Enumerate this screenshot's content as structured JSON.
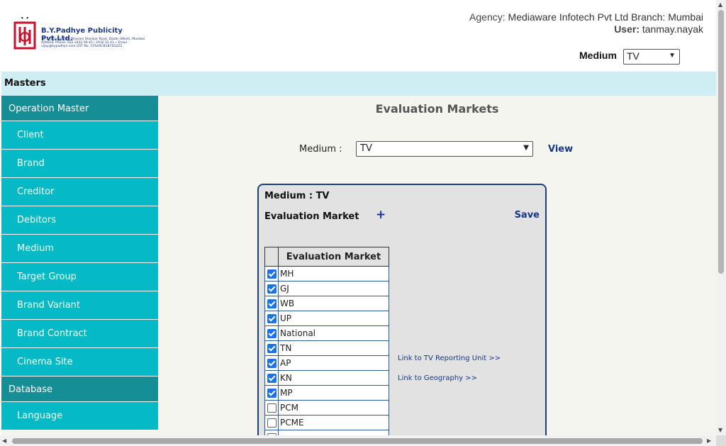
{
  "header": {
    "logo_name": "B.Y.Padhye Publicity Pvt.Ltd.",
    "logo_address": "32-E, Shivganesh, Bhavani Shankar Road, Dadar (West), Mumbai 400028. Phone: 022 2432 06 45 / 2432 52 41 • Email : vijay@bypadhye.com GST No. 27AAACB1871D2Z2",
    "agency_label": "Agency:",
    "agency_value": "Mediaware Infotech Pvt Ltd Branch: Mumbai",
    "user_label": "User:",
    "user_value": "tanmay.nayak",
    "medium_label": "Medium",
    "medium_value": "TV"
  },
  "masters_bar": {
    "label": "Masters"
  },
  "sidebar": {
    "groups": [
      {
        "label": "Operation Master",
        "items": [
          "Client",
          "Brand",
          "Creditor",
          "Debitors",
          "Medium",
          "Target Group",
          "Brand Variant",
          "Brand Contract",
          "Cinema Site"
        ]
      },
      {
        "label": "Database",
        "items": [
          "Language"
        ]
      }
    ]
  },
  "main": {
    "title": "Evaluation Markets",
    "medium_label": "Medium :",
    "medium_value": "TV",
    "view_label": "View",
    "panel": {
      "medium_caption": "Medium : TV",
      "evaluation_market_label": "Evaluation Market",
      "add_symbol": "+",
      "save_label": "Save",
      "grid_header": "Evaluation Market",
      "rows": [
        {
          "name": "MH",
          "checked": true
        },
        {
          "name": "GJ",
          "checked": true
        },
        {
          "name": "WB",
          "checked": true
        },
        {
          "name": "UP",
          "checked": true
        },
        {
          "name": "National",
          "checked": true
        },
        {
          "name": "TN",
          "checked": true
        },
        {
          "name": "AP",
          "checked": true
        },
        {
          "name": "KN",
          "checked": true
        },
        {
          "name": "MP",
          "checked": true
        },
        {
          "name": "PCM",
          "checked": false
        },
        {
          "name": "PCME",
          "checked": false
        },
        {
          "name": "",
          "checked": false
        }
      ],
      "link_tv_reporting": "Link to TV Reporting Unit >>",
      "link_geography": "Link to Geography >>"
    }
  },
  "colors": {
    "sidebar_group": "#168e96",
    "sidebar_item": "#05b9c6",
    "masters_bar": "#cfeef3",
    "link": "#16368a",
    "panel_border": "#1c3f7a"
  }
}
